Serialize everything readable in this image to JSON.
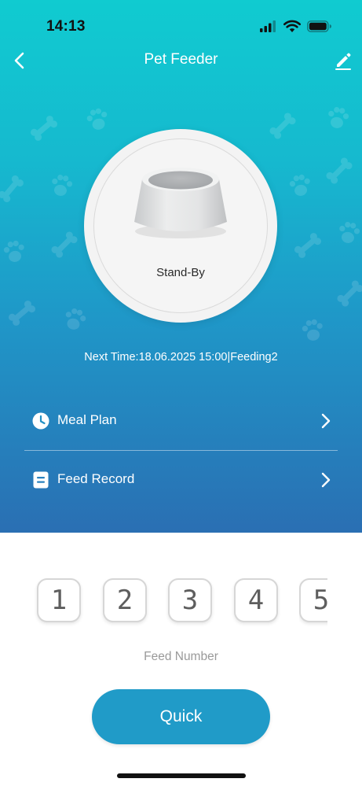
{
  "status_bar": {
    "time": "14:13"
  },
  "nav": {
    "title": "Pet Feeder",
    "back_icon": "chevron-left-icon",
    "edit_icon": "pencil-icon"
  },
  "device": {
    "status": "Stand-By",
    "next_time": "Next Time:18.06.2025 15:00|Feeding2"
  },
  "menu": {
    "items": [
      {
        "label": "Meal Plan",
        "icon": "clock-icon"
      },
      {
        "label": "Feed Record",
        "icon": "record-icon"
      }
    ]
  },
  "feed": {
    "numbers": [
      "1",
      "2",
      "3",
      "4",
      "5"
    ],
    "label": "Feed Number"
  },
  "actions": {
    "quick_label": "Quick"
  },
  "colors": {
    "gradient_top": "#10cbd0",
    "gradient_bottom": "#2a6fb3",
    "button": "#209bc8"
  }
}
